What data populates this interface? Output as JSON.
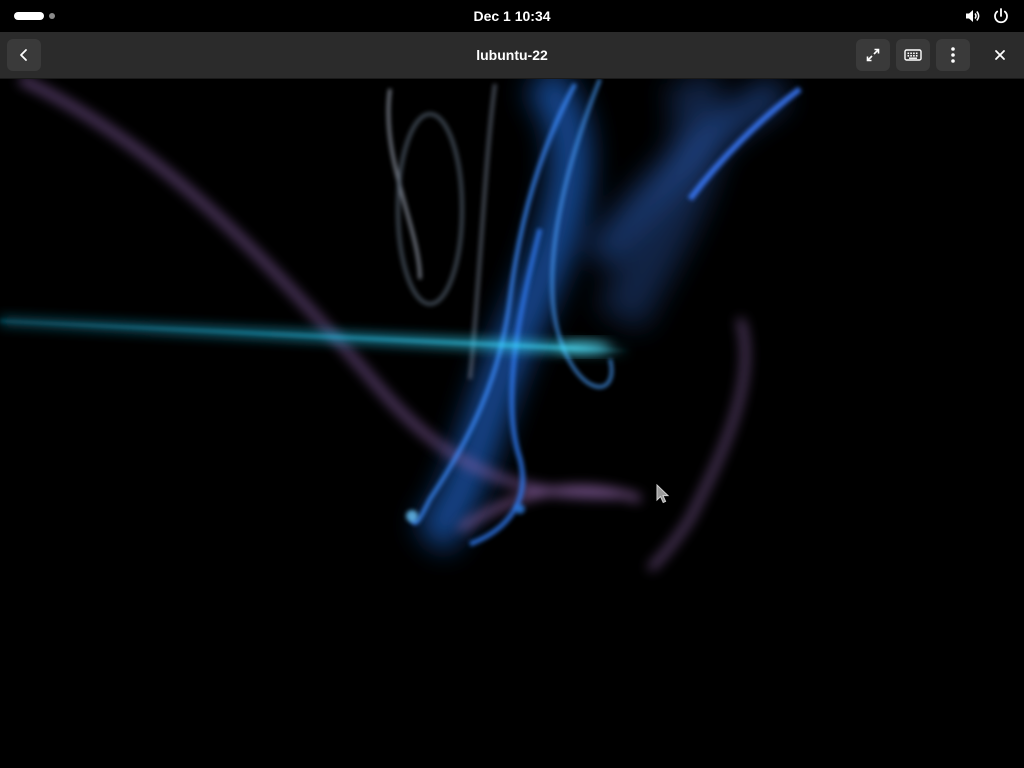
{
  "topbar": {
    "activities_label": "Activities",
    "clock": "Dec 1  10:34",
    "icons": [
      "volume-icon",
      "power-icon"
    ]
  },
  "headerbar": {
    "title": "lubuntu-22",
    "buttons": [
      "back-button",
      "fullscreen-button",
      "keyboard-button",
      "menu-button",
      "close-button"
    ]
  },
  "remote": {
    "content": "lubuntu desktop wallpaper (abstract light streaks)",
    "colors": {
      "background": "#000000",
      "cyan": "#2ad4ff",
      "blue": "#2b7bff",
      "violet": "#9a6fb8"
    }
  }
}
